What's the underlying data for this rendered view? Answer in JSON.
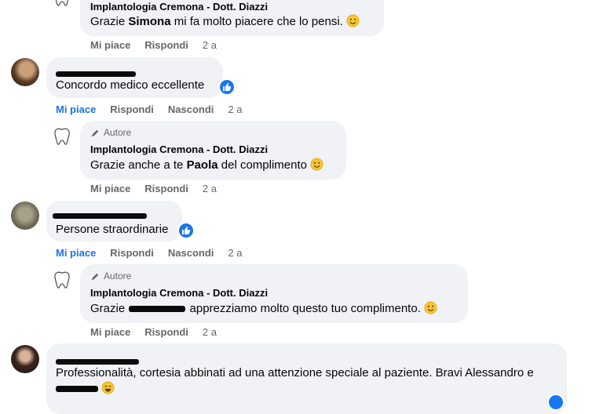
{
  "comments": [
    {
      "author": "Implantologia Cremona - Dott. Diazzi",
      "text_pre": "Grazie ",
      "text_bold": "Simona",
      "text_post": " mi fa molto piacere che lo pensi.",
      "actions": {
        "like": "Mi piace",
        "reply": "Rispondi",
        "time": "2 a"
      }
    },
    {
      "text": "Concordo medico eccellente",
      "actions": {
        "like": "Mi piace",
        "reply": "Rispondi",
        "hide": "Nascondi",
        "time": "2 a"
      }
    },
    {
      "badge": "Autore",
      "author": "Implantologia Cremona - Dott. Diazzi",
      "text_pre": "Grazie anche a te ",
      "text_bold": "Paola",
      "text_post": " del complimento",
      "actions": {
        "like": "Mi piace",
        "reply": "Rispondi",
        "time": "2 a"
      }
    },
    {
      "text": "Persone straordinarie",
      "actions": {
        "like": "Mi piace",
        "reply": "Rispondi",
        "hide": "Nascondi",
        "time": "2 a"
      }
    },
    {
      "badge": "Autore",
      "author": "Implantologia Cremona - Dott. Diazzi",
      "text_pre": "Grazie ",
      "text_post": " apprezziamo molto questo tuo complimento.",
      "actions": {
        "like": "Mi piace",
        "reply": "Rispondi",
        "time": "2 a"
      }
    },
    {
      "text": "Professionalità, cortesia abbinati ad una attenzione speciale al paziente. Bravi Alessandro e"
    }
  ],
  "colors": {
    "bubble": "#f0f2f5",
    "link_blue": "#1b74e4",
    "like_blue": "#1877f2",
    "meta_gray": "#65676b"
  }
}
